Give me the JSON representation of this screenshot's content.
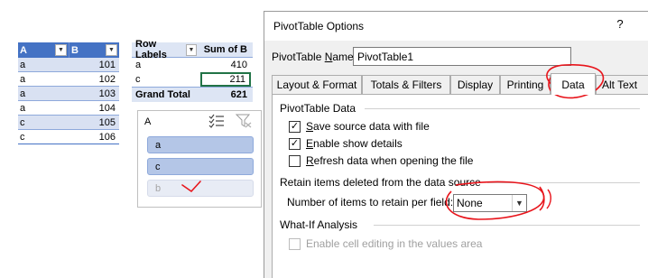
{
  "source_table": {
    "headers": [
      "A",
      "B"
    ],
    "rows": [
      {
        "a": "a",
        "b": "101"
      },
      {
        "a": "a",
        "b": "102"
      },
      {
        "a": "a",
        "b": "103"
      },
      {
        "a": "a",
        "b": "104"
      },
      {
        "a": "c",
        "b": "105"
      },
      {
        "a": "c",
        "b": "106"
      }
    ]
  },
  "pivot": {
    "header_labels": "Row Labels",
    "header_sum": "Sum of B",
    "rows": [
      {
        "label": "a",
        "value": "410"
      },
      {
        "label": "c",
        "value": "211"
      }
    ],
    "total_label": "Grand Total",
    "total_value": "621"
  },
  "slicer": {
    "title": "A",
    "items": [
      {
        "label": "a",
        "state": "selected"
      },
      {
        "label": "c",
        "state": "selected"
      },
      {
        "label": "b",
        "state": "no-data"
      }
    ]
  },
  "dialog": {
    "title": "PivotTable Options",
    "help": "?",
    "name_label_prefix": "PivotTable ",
    "name_label_key": "N",
    "name_label_suffix": "ame:",
    "name_value": "PivotTable1",
    "tabs": [
      "Layout & Format",
      "Totals & Filters",
      "Display",
      "Printing",
      "Data",
      "Alt Text"
    ],
    "active_tab": "Data",
    "group_pivot_data": "PivotTable Data",
    "save_source": {
      "key": "S",
      "rest": "ave source data with file",
      "checked": true
    },
    "enable_details": {
      "key": "E",
      "rest": "nable show details",
      "checked": true
    },
    "refresh_open": {
      "key": "R",
      "rest": "efresh data when opening the file",
      "checked": false
    },
    "group_retain": "Retain items deleted from the data source",
    "retain_label": "Number of items to retain per field:",
    "retain_value": "None",
    "group_whatif": "What-If Analysis",
    "enable_editing": {
      "label": "Enable cell editing in the values area",
      "checked": false,
      "disabled": true
    }
  },
  "icons": {
    "multi_select": "multi-select-icon",
    "clear_filter": "clear-filter-icon",
    "dropdown": "chevron-down-icon",
    "checkmark": "checkmark-icon"
  },
  "colors": {
    "header_blue": "#4472c4",
    "band_blue": "#d9e1f2",
    "slicer_selected": "#b4c6e7",
    "annotation_red": "#e8141b",
    "selection_green": "#217346"
  }
}
